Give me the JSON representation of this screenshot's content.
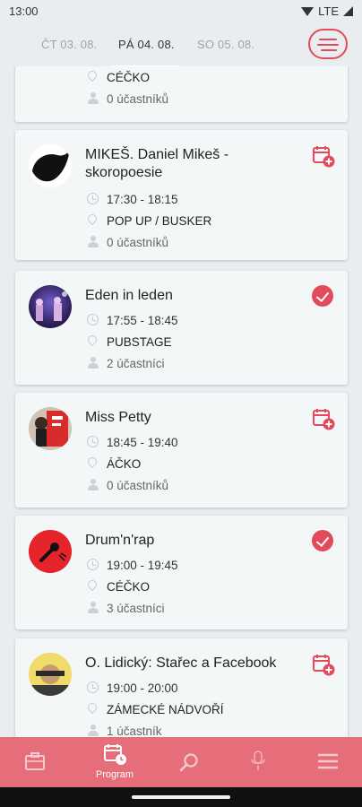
{
  "status_bar": {
    "time": "13:00",
    "network": "LTE"
  },
  "day_tabs": [
    {
      "label": "ČT 03. 08.",
      "active": false
    },
    {
      "label": "PÁ 04. 08.",
      "active": true
    },
    {
      "label": "SO 05. 08.",
      "active": false
    }
  ],
  "events": [
    {
      "title": "",
      "time": "",
      "place": "CÉČKO",
      "participants": "0 účastníků",
      "status": "add",
      "avatar": "none"
    },
    {
      "title": "MIKEŠ. Daniel Mikeš - skoropoesie",
      "time": "17:30 - 18:15",
      "place": "POP UP / BUSKER",
      "participants": "0 účastníků",
      "status": "add",
      "avatar": "black-bird"
    },
    {
      "title": "Eden in leden",
      "time": "17:55 - 18:45",
      "place": "PUBSTAGE",
      "participants": "2 účastníci",
      "status": "joined",
      "avatar": "stage-purple"
    },
    {
      "title": "Miss Petty",
      "time": "18:45 - 19:40",
      "place": "ÁČKO",
      "participants": "0 účastníků",
      "status": "add",
      "avatar": "red-poster"
    },
    {
      "title": "Drum'n'rap",
      "time": "19:00 - 19:45",
      "place": "CÉČKO",
      "participants": "3 účastníci",
      "status": "joined",
      "avatar": "red-mic"
    },
    {
      "title": "O. Lidický: Stařec a Facebook",
      "time": "19:00 - 20:00",
      "place": "ZÁMECKÉ NÁDVOŘÍ",
      "participants": "1 účastník",
      "status": "add",
      "avatar": "yellow-photo"
    }
  ],
  "bottom_nav": [
    {
      "icon": "ticket-icon",
      "label": ""
    },
    {
      "icon": "program-calendar-icon",
      "label": "Program",
      "active": true
    },
    {
      "icon": "search-icon",
      "label": ""
    },
    {
      "icon": "microphone-icon",
      "label": ""
    },
    {
      "icon": "menu-icon",
      "label": ""
    }
  ],
  "colors": {
    "accent": "#e34b5b",
    "nav_background": "#e66d7a",
    "card": "#f4f7f8",
    "page": "#e9edef"
  }
}
